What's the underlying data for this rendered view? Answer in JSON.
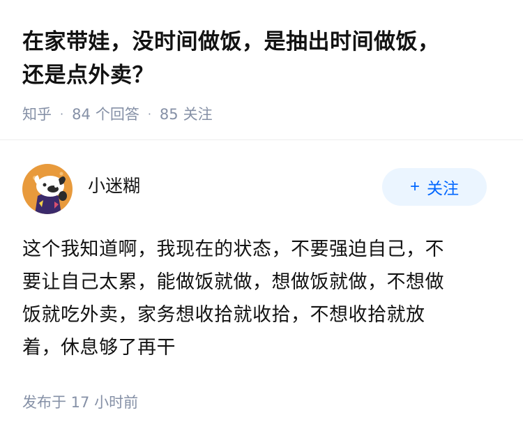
{
  "question": {
    "title_lines": [
      "在家带娃，没时间做饭，是抽出时间做饭，",
      "还是点外卖？"
    ],
    "source": "知乎",
    "answer_count": "84",
    "answer_label": "个回答",
    "follower_count": "85",
    "follower_label": "关注"
  },
  "answer": {
    "author_name": "小迷糊",
    "follow_label": "关注",
    "follow_icon": "plus-icon",
    "avatar_icon": "cartoon-dog-avatar",
    "content_lines": [
      "这个我知道啊，我现在的状态，不要强迫自己，不",
      "要让自己太累，能做饭就做，想做饭就做，不想做",
      "饭就吃外卖，家务想收拾就收拾，不想收拾就放",
      "着，休息够了再干"
    ],
    "publish_time": "发布于 17 小时前"
  },
  "colors": {
    "accent": "#0066ff",
    "follow_bg": "#ebf5ff",
    "meta_text": "#8590a6",
    "avatar_bg": "#e89a3c"
  }
}
